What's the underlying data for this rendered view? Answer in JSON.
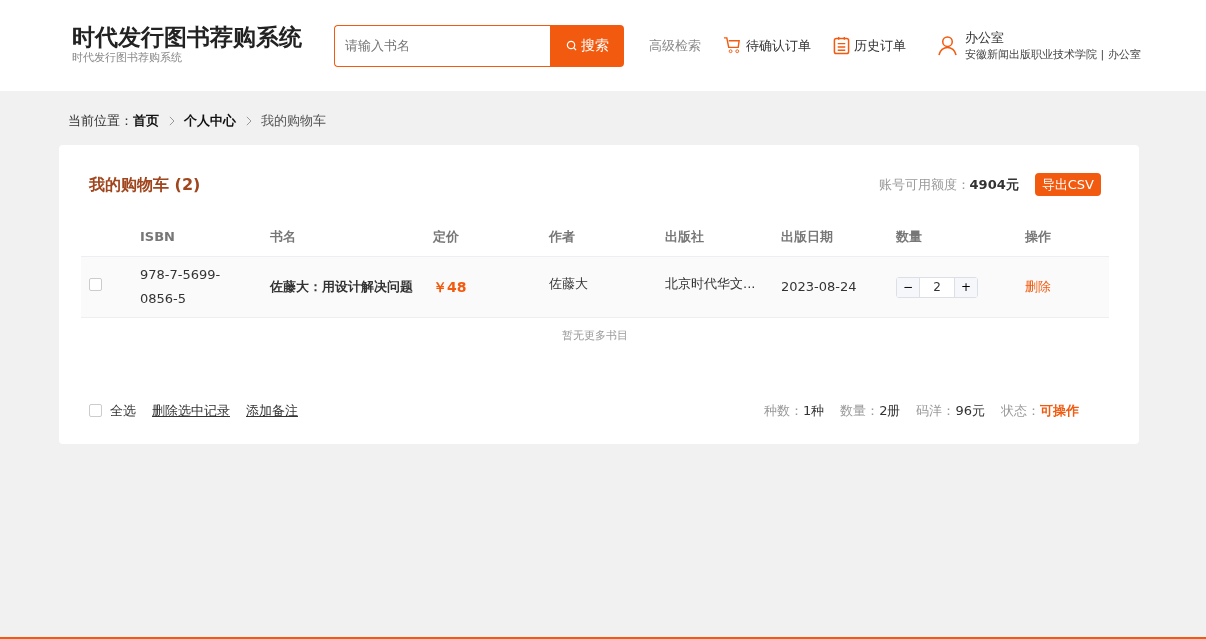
{
  "header": {
    "title": "时代发行图书荐购系统",
    "subtitle": "时代发行图书荐购系统",
    "search": {
      "placeholder": "请输入书名",
      "button": "搜索"
    },
    "nav": [
      {
        "kind": "text",
        "label": "高级检索"
      },
      {
        "kind": "cart",
        "label": "待确认订单"
      },
      {
        "kind": "list",
        "label": "历史订单"
      }
    ],
    "user": {
      "name": "办公室",
      "org": "安徽新闻出版职业技术学院 | 办公室"
    }
  },
  "breadcrumb": {
    "label": "当前位置：",
    "items": [
      "首页",
      "个人中心",
      "我的购物车"
    ]
  },
  "cart": {
    "title": "我的购物车 (2)",
    "credit_label": "账号可用额度：",
    "credit": "4904元",
    "export_button": "导出CSV",
    "columns": [
      "ISBN",
      "书名",
      "定价",
      "作者",
      "出版社",
      "出版日期",
      "数量",
      "操作"
    ],
    "rows": [
      {
        "checked": false,
        "isbn": "978-7-5699-0856-5",
        "title": "佐藤大：用设计解决问题",
        "price": "￥48",
        "author": "佐藤大",
        "publisher": "北京时代华文...",
        "date": "2023-08-24",
        "minus": "−",
        "quantity": "2",
        "plus": "+",
        "action": "删除"
      }
    ],
    "empty_note": "暂无更多书目",
    "footer": {
      "select_all": {
        "label": "全选",
        "checked": false
      },
      "links": [
        "删除选中记录",
        "添加备注"
      ],
      "stats": [
        {
          "label": "种数：",
          "value": "1种",
          "kind": "plain"
        },
        {
          "label": "数量：",
          "value": "2册",
          "kind": "plain"
        },
        {
          "label": "码洋：",
          "value": "96元",
          "kind": "plain"
        },
        {
          "label": "状态：",
          "value": "可操作",
          "kind": "status"
        }
      ]
    }
  }
}
